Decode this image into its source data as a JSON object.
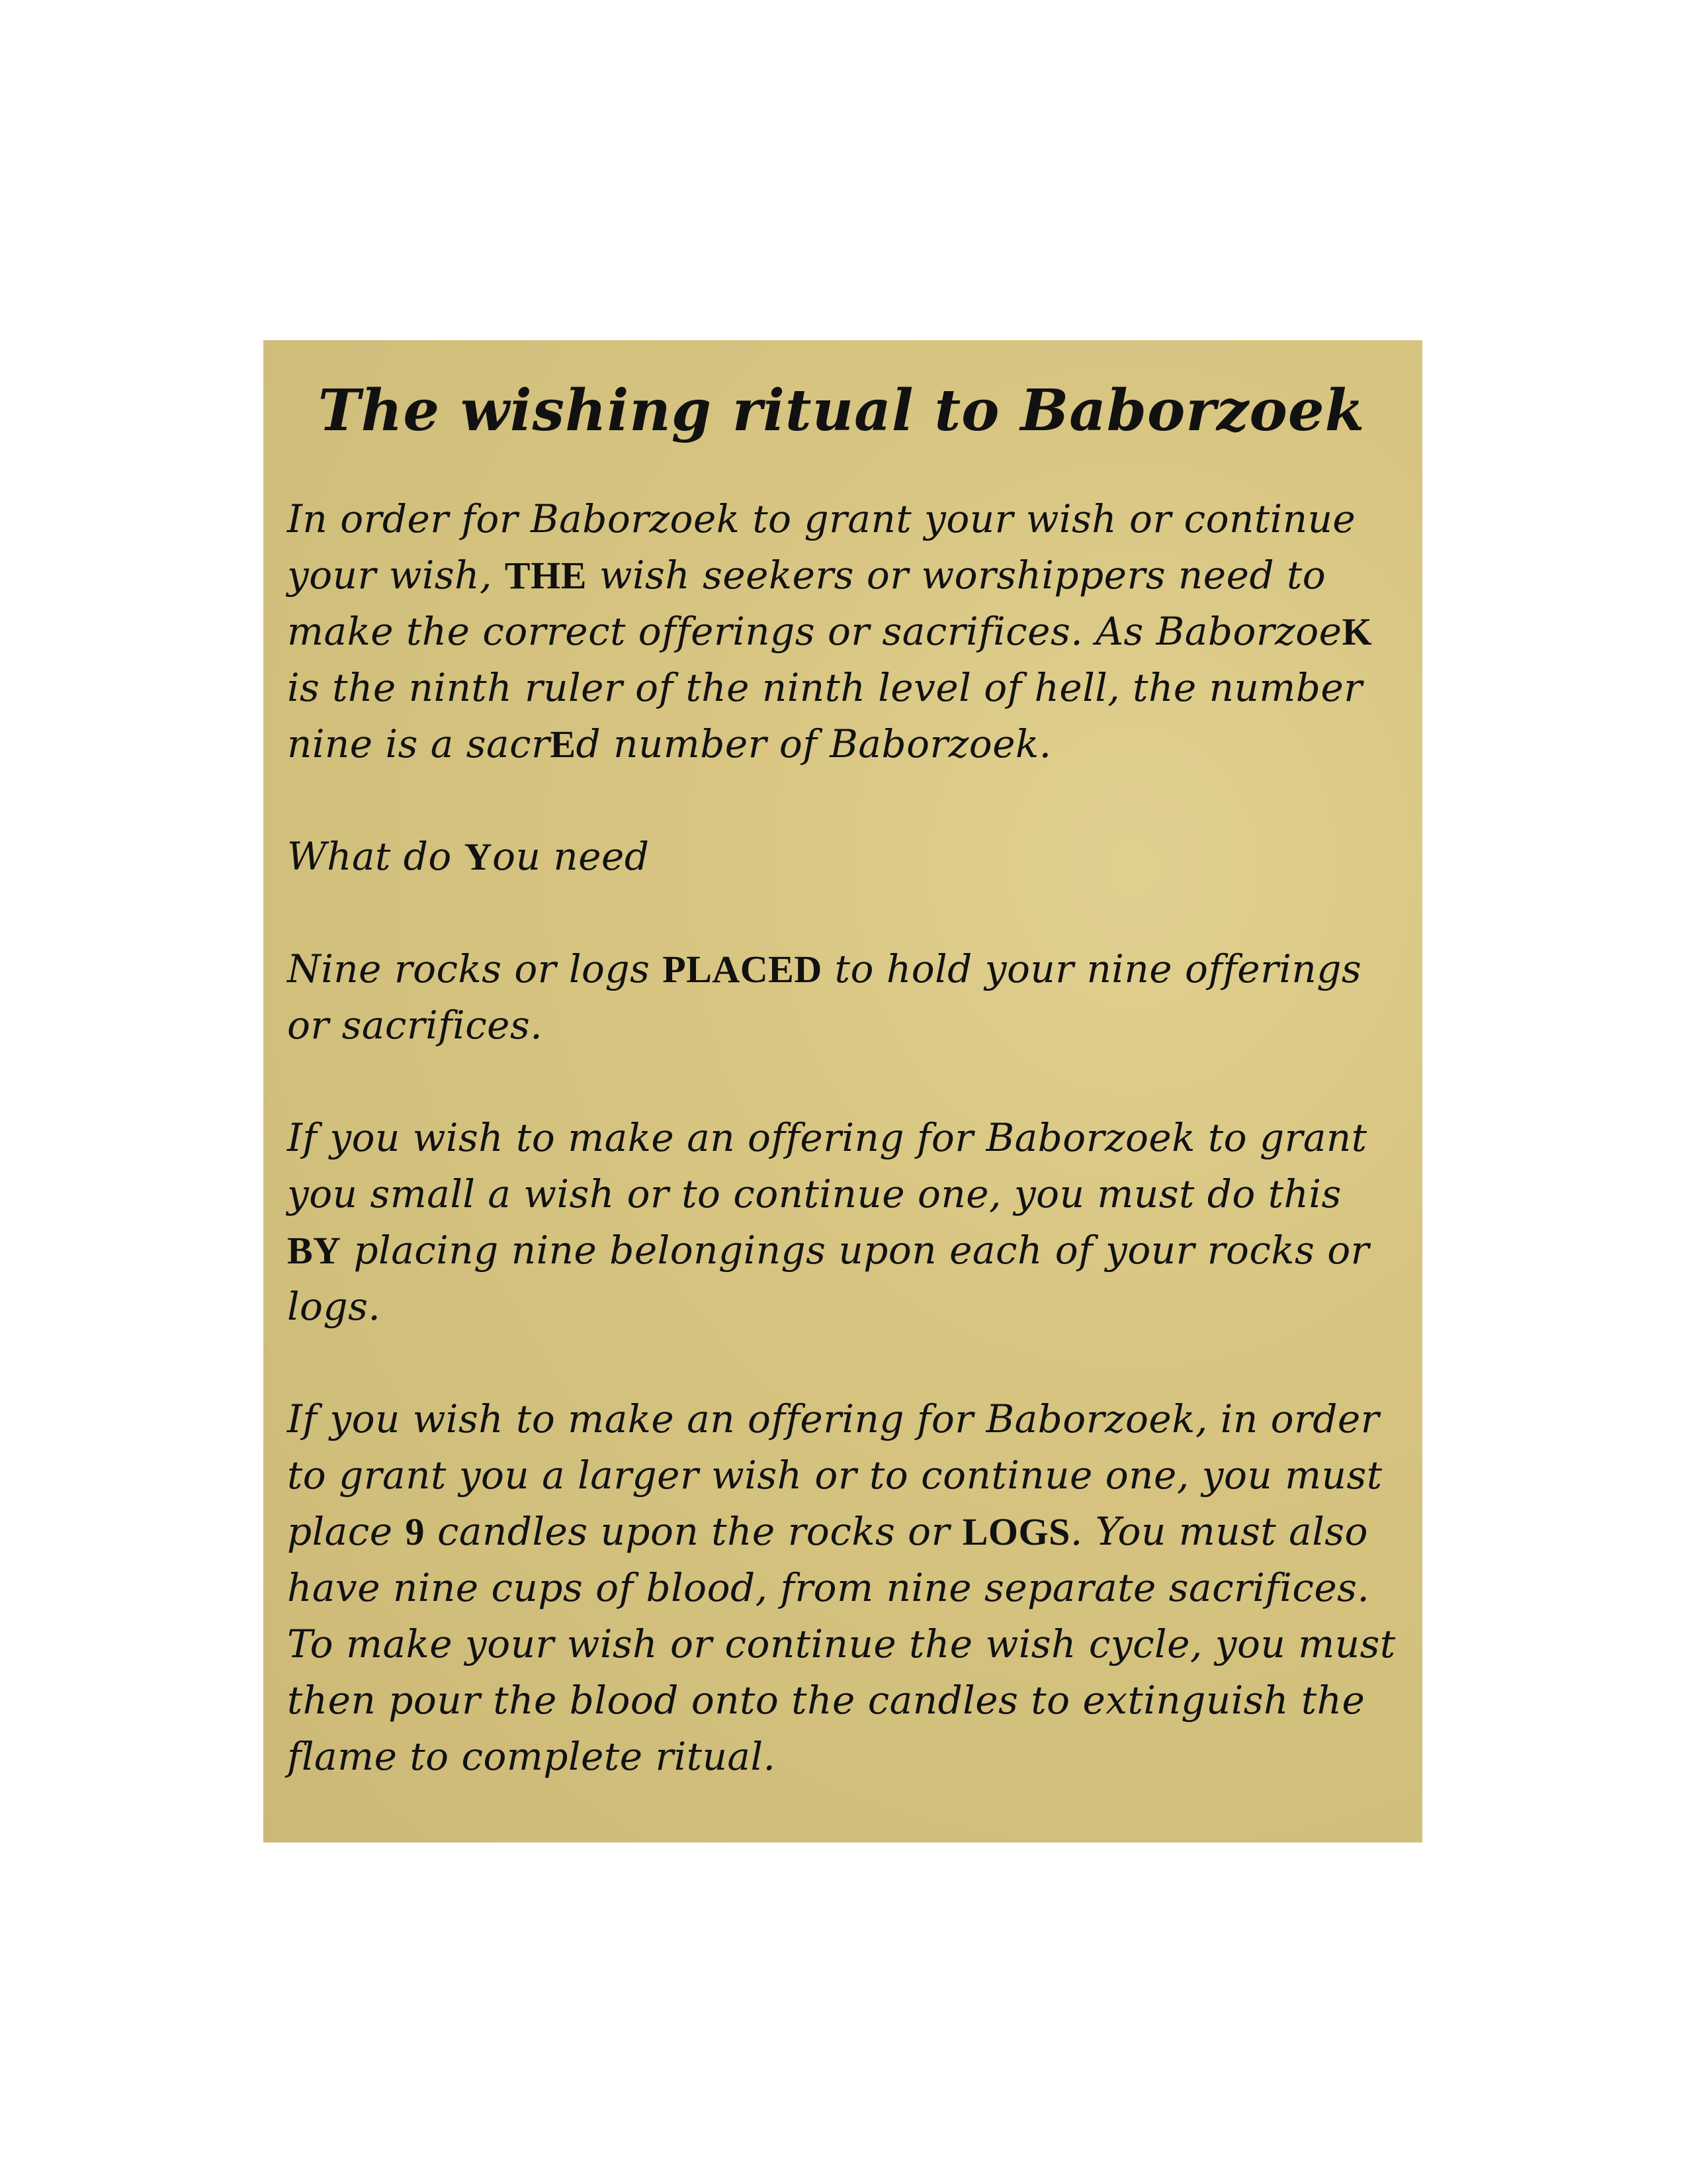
{
  "document": {
    "title": "The wishing ritual to Baborzoek",
    "paragraphs": [
      [
        {
          "t": "In order for Baborzoek to grant your wish or continue your wish, "
        },
        {
          "t": "THE",
          "caps": true
        },
        {
          "t": " wish seekers or worshippers need to make the correct offerings or sacrifices. As Baborzoe"
        },
        {
          "t": "K",
          "caps": true
        },
        {
          "t": " is the ninth ruler of the ninth level of hell, the number nine is a sacr"
        },
        {
          "t": "E",
          "caps": true
        },
        {
          "t": "d number of Baborzoek."
        }
      ],
      [
        {
          "t": "What do "
        },
        {
          "t": "Y",
          "caps": true
        },
        {
          "t": "ou need"
        }
      ],
      [
        {
          "t": "Nine rocks or logs "
        },
        {
          "t": "PLACED",
          "caps": true
        },
        {
          "t": " to hold your nine offerings or sacrifices."
        }
      ],
      [
        {
          "t": "If you wish to make an offering for Baborzoek to grant you small a wish or to continue one, you must do this "
        },
        {
          "t": "BY",
          "caps": true
        },
        {
          "t": " placing nine belongings upon each of your rocks or logs."
        }
      ],
      [
        {
          "t": "If you wish to make an offering for Baborzoek, in order to grant you a larger wish or to continue one, you must place "
        },
        {
          "t": "9",
          "caps": true
        },
        {
          "t": " candles upon the rocks or "
        },
        {
          "t": "LOGS",
          "caps": true
        },
        {
          "t": ". You must also have nine cups of blood, from nine separate sacrifices. To make your wish or continue the wish cycle, you must then pour the blood onto the candles to extinguish the flame to complete ritual."
        }
      ]
    ]
  },
  "colors": {
    "page_background": "#ffffff",
    "parchment": "#d6c480",
    "text": "#111111"
  }
}
